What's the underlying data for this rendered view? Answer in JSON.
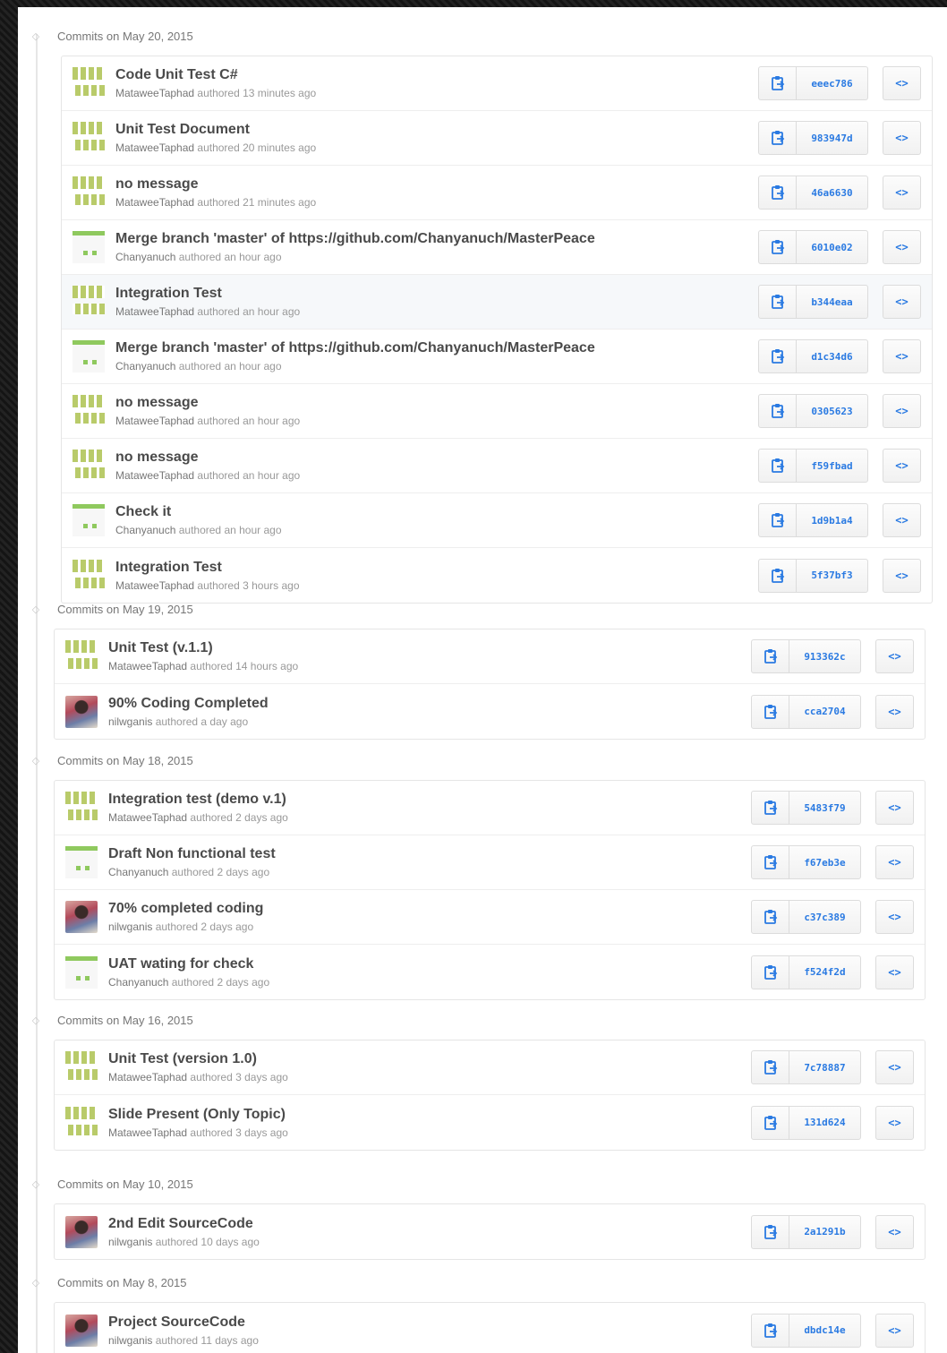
{
  "groups": [
    {
      "date": "Commits on May 20, 2015",
      "commits": [
        {
          "title": "Code Unit Test C#",
          "author": "MataweeTaphad",
          "time": "authored 13 minutes ago",
          "sha": "eeec786",
          "avatar": "mataweetaphad-avatar"
        },
        {
          "title": "Unit Test Document",
          "author": "MataweeTaphad",
          "time": "authored 20 minutes ago",
          "sha": "983947d",
          "avatar": "mataweetaphad-avatar"
        },
        {
          "title": "no message",
          "author": "MataweeTaphad",
          "time": "authored 21 minutes ago",
          "sha": "46a6630",
          "avatar": "mataweetaphad-avatar"
        },
        {
          "title": "Merge branch 'master' of https://github.com/Chanyanuch/MasterPeace",
          "author": "Chanyanuch",
          "time": "authored an hour ago",
          "sha": "6010e02",
          "avatar": "chanyanuch-avatar"
        },
        {
          "title": "Integration Test",
          "author": "MataweeTaphad",
          "time": "authored an hour ago",
          "sha": "b344eaa",
          "avatar": "mataweetaphad-avatar",
          "highlighted": true
        },
        {
          "title": "Merge branch 'master' of https://github.com/Chanyanuch/MasterPeace",
          "author": "Chanyanuch",
          "time": "authored an hour ago",
          "sha": "d1c34d6",
          "avatar": "chanyanuch-avatar"
        },
        {
          "title": "no message",
          "author": "MataweeTaphad",
          "time": "authored an hour ago",
          "sha": "0305623",
          "avatar": "mataweetaphad-avatar"
        },
        {
          "title": "no message",
          "author": "MataweeTaphad",
          "time": "authored an hour ago",
          "sha": "f59fbad",
          "avatar": "mataweetaphad-avatar"
        },
        {
          "title": "Check it",
          "author": "Chanyanuch",
          "time": "authored an hour ago",
          "sha": "1d9b1a4",
          "avatar": "chanyanuch-avatar"
        },
        {
          "title": "Integration Test",
          "author": "MataweeTaphad",
          "time": "authored 3 hours ago",
          "sha": "5f37bf3",
          "avatar": "mataweetaphad-avatar"
        }
      ]
    },
    {
      "date": "Commits on May 19, 2015",
      "commits": [
        {
          "title": "Unit Test (v.1.1)",
          "author": "MataweeTaphad",
          "time": "authored 14 hours ago",
          "sha": "913362c",
          "avatar": "mataweetaphad-avatar"
        },
        {
          "title": "90% Coding Completed",
          "author": "nilwganis",
          "time": "authored a day ago",
          "sha": "cca2704",
          "avatar": "nilwganis-avatar"
        }
      ]
    },
    {
      "date": "Commits on May 18, 2015",
      "commits": [
        {
          "title": "Integration test (demo v.1)",
          "author": "MataweeTaphad",
          "time": "authored 2 days ago",
          "sha": "5483f79",
          "avatar": "mataweetaphad-avatar"
        },
        {
          "title": "Draft Non functional test",
          "author": "Chanyanuch",
          "time": "authored 2 days ago",
          "sha": "f67eb3e",
          "avatar": "chanyanuch-avatar"
        },
        {
          "title": "70% completed coding",
          "author": "nilwganis",
          "time": "authored 2 days ago",
          "sha": "c37c389",
          "avatar": "nilwganis-avatar"
        },
        {
          "title": "UAT wating for check",
          "author": "Chanyanuch",
          "time": "authored 2 days ago",
          "sha": "f524f2d",
          "avatar": "chanyanuch-avatar"
        }
      ]
    },
    {
      "date": "Commits on May 16, 2015",
      "commits": [
        {
          "title": "Unit Test (version 1.0)",
          "author": "MataweeTaphad",
          "time": "authored 3 days ago",
          "sha": "7c78887",
          "avatar": "mataweetaphad-avatar"
        },
        {
          "title": "Slide Present (Only Topic)",
          "author": "MataweeTaphad",
          "time": "authored 3 days ago",
          "sha": "131d624",
          "avatar": "mataweetaphad-avatar"
        }
      ]
    },
    {
      "date": "Commits on May 10, 2015",
      "commits": [
        {
          "title": "2nd Edit SourceCode",
          "author": "nilwganis",
          "time": "authored 10 days ago",
          "sha": "2a1291b",
          "avatar": "nilwganis-avatar"
        }
      ]
    },
    {
      "date": "Commits on May 8, 2015",
      "commits": [
        {
          "title": "Project SourceCode",
          "author": "nilwganis",
          "time": "authored 11 days ago",
          "sha": "dbdc14e",
          "avatar": "nilwganis-avatar"
        }
      ]
    }
  ],
  "browse_label": "<>",
  "colors": {
    "link": "#2a7ae2",
    "title": "#4a4a4a",
    "meta": "#999999"
  }
}
